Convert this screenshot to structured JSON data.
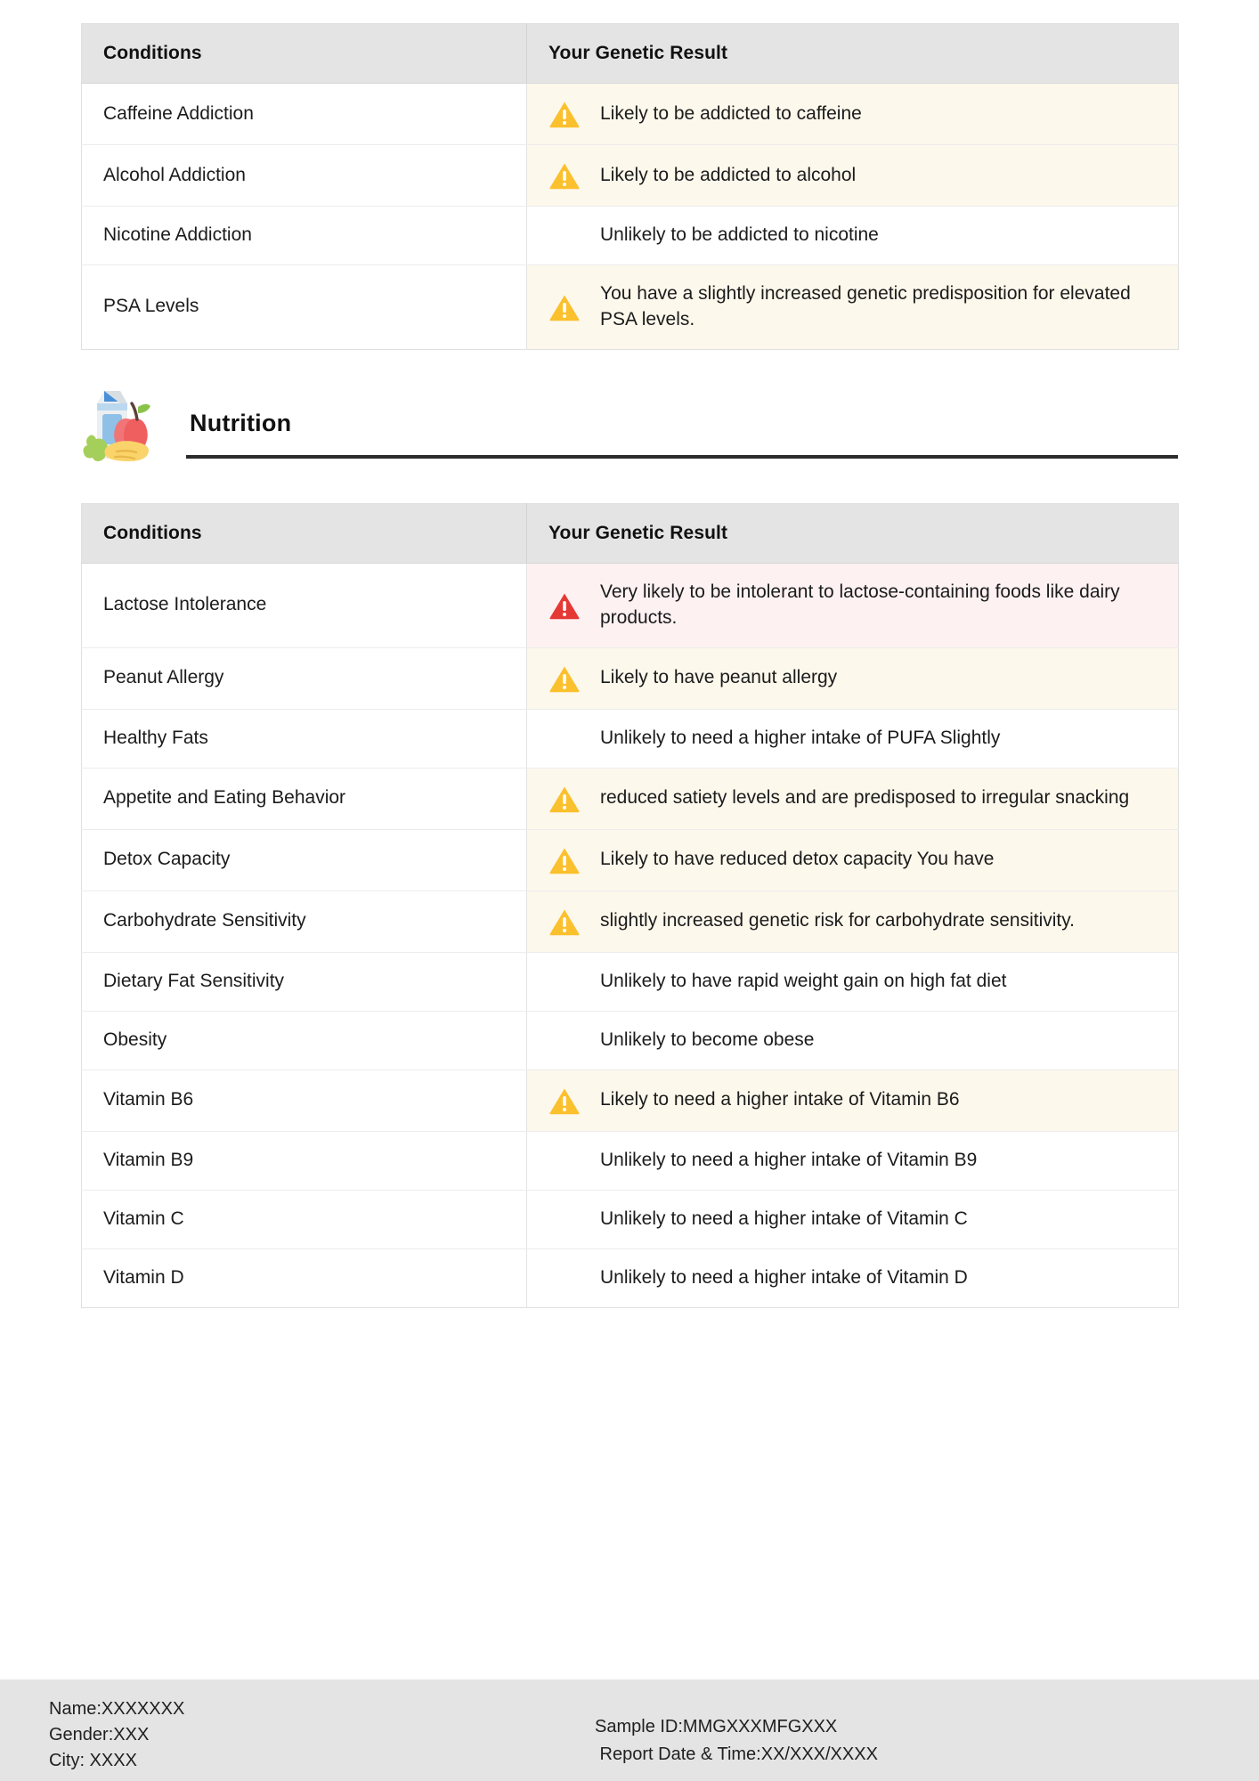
{
  "tables": [
    {
      "id": "addiction-table",
      "columns": [
        "Conditions",
        "Your Genetic Result"
      ],
      "rows": [
        {
          "condition": "Caffeine Addiction",
          "result": "Likely to be addicted to caffeine",
          "severity": "warn",
          "icon": "warning-triangle-yellow-icon"
        },
        {
          "condition": "Alcohol Addiction",
          "result": "Likely to be addicted to alcohol",
          "severity": "warn",
          "icon": "warning-triangle-yellow-icon"
        },
        {
          "condition": "Nicotine Addiction",
          "result": "Unlikely to be addicted to nicotine",
          "severity": "none",
          "icon": ""
        },
        {
          "condition": "PSA Levels",
          "result": "You have a slightly increased genetic predisposition for elevated PSA levels.",
          "severity": "warn",
          "icon": "warning-triangle-yellow-icon"
        }
      ]
    },
    {
      "id": "nutrition-table",
      "columns": [
        "Conditions",
        "Your Genetic Result"
      ],
      "rows": [
        {
          "condition": "Lactose Intolerance",
          "result": "Very likely to be intolerant to lactose-containing foods like dairy products.",
          "severity": "high",
          "icon": "warning-triangle-red-icon"
        },
        {
          "condition": "Peanut Allergy",
          "result": "Likely to have peanut allergy",
          "severity": "warn",
          "icon": "warning-triangle-yellow-icon"
        },
        {
          "condition": "Healthy Fats",
          "result": "Unlikely to need a higher intake of PUFA Slightly",
          "severity": "none",
          "icon": ""
        },
        {
          "condition": "Appetite and Eating Behavior",
          "result": "reduced satiety levels and are predisposed to irregular snacking",
          "severity": "warn",
          "icon": "warning-triangle-yellow-icon"
        },
        {
          "condition": "Detox Capacity",
          "result": "Likely to have reduced detox capacity You have",
          "severity": "warn",
          "icon": "warning-triangle-yellow-icon"
        },
        {
          "condition": "Carbohydrate Sensitivity",
          "result": "slightly increased genetic risk for carbohydrate sensitivity.",
          "severity": "warn",
          "icon": "warning-triangle-yellow-icon"
        },
        {
          "condition": "Dietary Fat Sensitivity",
          "result": "Unlikely to have rapid weight gain on high fat diet",
          "severity": "none",
          "icon": ""
        },
        {
          "condition": "Obesity",
          "result": "Unlikely to become obese",
          "severity": "none",
          "icon": ""
        },
        {
          "condition": "Vitamin B6",
          "result": "Likely to need a higher intake of Vitamin B6",
          "severity": "warn",
          "icon": "warning-triangle-yellow-icon"
        },
        {
          "condition": "Vitamin B9",
          "result": "Unlikely to need a higher intake of Vitamin B9",
          "severity": "none",
          "icon": ""
        },
        {
          "condition": "Vitamin C",
          "result": "Unlikely to need a higher intake of Vitamin C",
          "severity": "none",
          "icon": ""
        },
        {
          "condition": "Vitamin D",
          "result": "Unlikely to need a higher intake of Vitamin D",
          "severity": "none",
          "icon": ""
        }
      ]
    }
  ],
  "nutrition_section": {
    "title": "Nutrition",
    "icon": "nutrition-food-icon"
  },
  "footer": {
    "name": "Name:XXXXXXX",
    "gender": "Gender:XXX",
    "city": "City: XXXX",
    "sample_id": "Sample ID:MMGXXXMFGXXX",
    "report_date": " Report Date & Time:XX/XXX/XXXX"
  },
  "colors": {
    "warning_yellow": "#FBC02D",
    "warning_red": "#E53935",
    "header_grey": "#e4e4e4",
    "warn_row_bg": "#fdf8ec",
    "high_row_bg": "#fdf1f2",
    "rule_dark": "#2b2b2b"
  }
}
